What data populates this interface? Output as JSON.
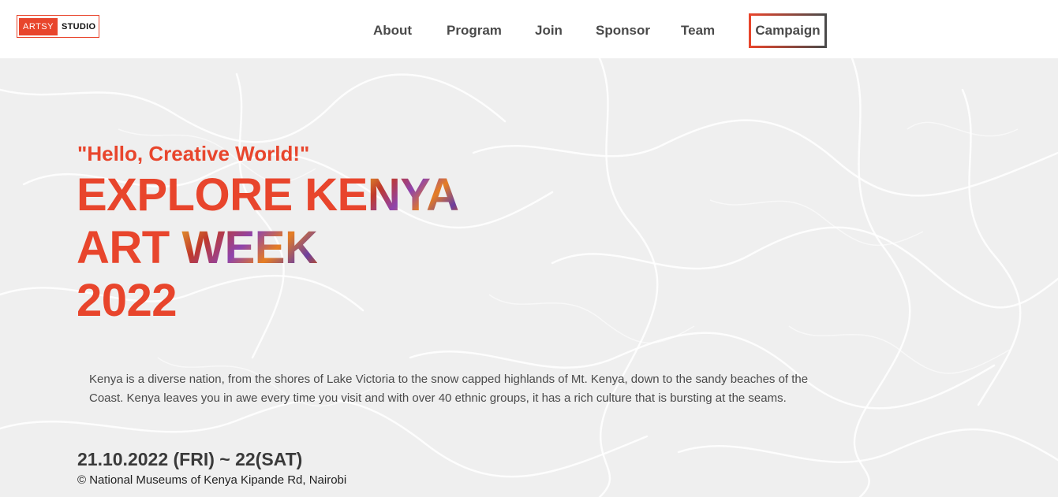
{
  "logo": {
    "part1": "ARTSY",
    "part2": "STUDIO",
    "accent": "#e8452c"
  },
  "nav": {
    "items": [
      {
        "label": "About"
      },
      {
        "label": "Program"
      },
      {
        "label": "Join"
      },
      {
        "label": "Sponsor"
      },
      {
        "label": "Team"
      }
    ],
    "cta_label": "Campaign"
  },
  "hero": {
    "tagline": "\"Hello, Creative World!\"",
    "headline": {
      "l1_a": "EXPLORE KE",
      "l1_b": "NYA",
      "l2_a": "ART ",
      "l2_b": "WEEK",
      "l3": "2022"
    },
    "description": "Kenya is a diverse nation, from the shores of Lake Victoria to the snow capped highlands of Mt. Kenya, down to the sandy beaches of the Coast. Kenya leaves you in awe every time you visit and with over 40 ethnic groups, it has a rich culture that is bursting at the seams.",
    "dates": "21.10.2022 (FRI) ~ 22(SAT)",
    "venue": "© National Museums of Kenya Kipande Rd, Nairobi"
  },
  "colors": {
    "brand": "#e8452c",
    "text": "#4a4a4a",
    "hero_bg": "#efefef"
  }
}
